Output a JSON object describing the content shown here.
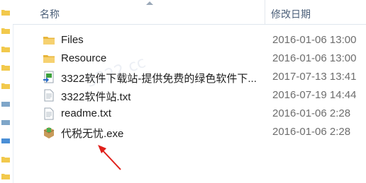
{
  "header": {
    "name_label": "名称",
    "date_label": "修改日期"
  },
  "files": [
    {
      "name": "Files",
      "modified": "2016-01-06 13:00",
      "icon": "folder-icon"
    },
    {
      "name": "Resource",
      "modified": "2016-01-06 13:00",
      "icon": "folder-icon"
    },
    {
      "name": "3322软件下载站-提供免费的绿色软件下...",
      "modified": "2017-07-13 13:41",
      "icon": "internet-shortcut-icon"
    },
    {
      "name": "3322软件站.txt",
      "modified": "2016-07-19 14:44",
      "icon": "text-file-icon"
    },
    {
      "name": "readme.txt",
      "modified": "2016-01-06 2:28",
      "icon": "text-file-icon"
    },
    {
      "name": "代税无忧.exe",
      "modified": "2016-01-06 2:28",
      "icon": "exe-app-icon"
    }
  ],
  "colors": {
    "folder": "#f2c94c",
    "annotation_arrow": "#e0201b",
    "header_text": "#4c607a"
  }
}
